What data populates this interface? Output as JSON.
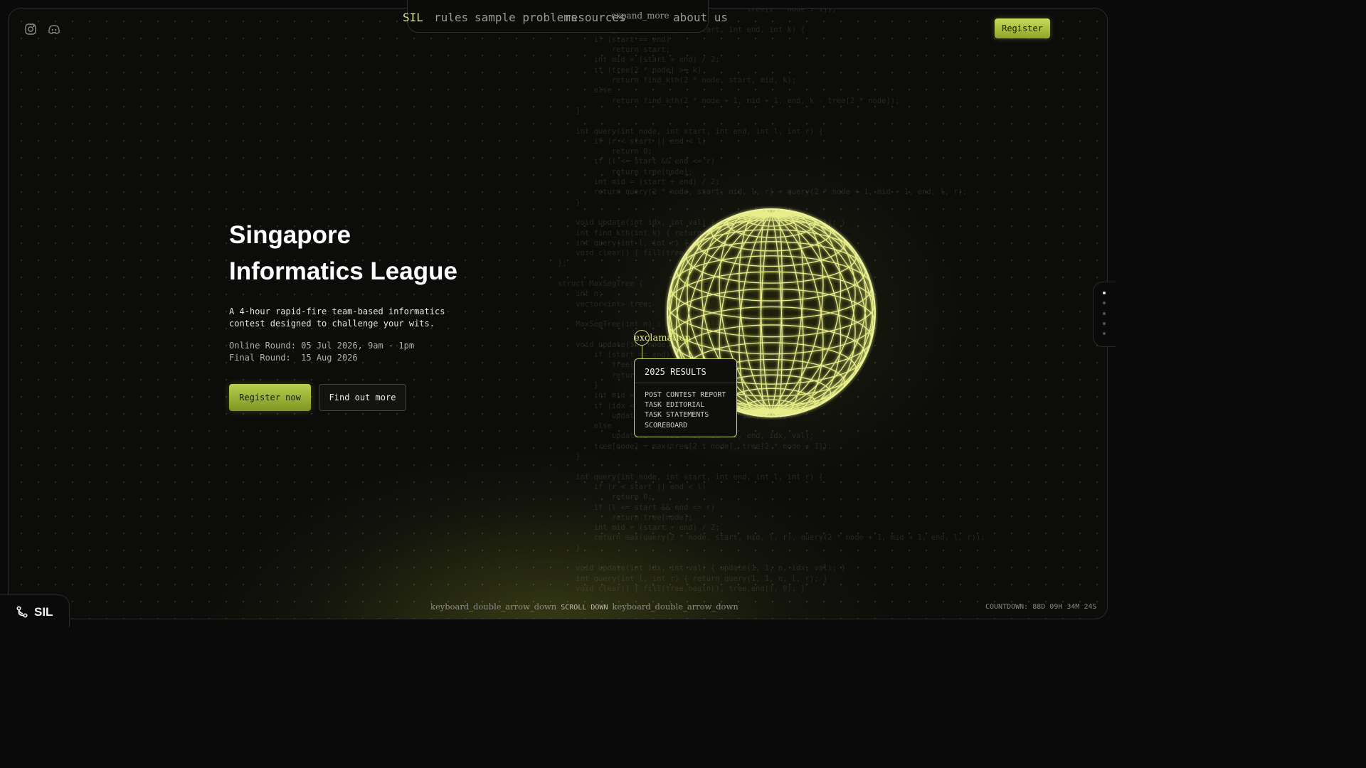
{
  "nav": {
    "items": [
      {
        "label": "SIL",
        "active": true
      },
      {
        "label": "rules"
      },
      {
        "label": "sample problems"
      },
      {
        "label": "resources"
      },
      {
        "label": "about us"
      }
    ],
    "resources_icon_text": "expand_more"
  },
  "socials": [
    {
      "icon": "instagram-icon"
    },
    {
      "icon": "discord-icon"
    }
  ],
  "header": {
    "register_label": "Register"
  },
  "hero": {
    "title_line1": "Singapore",
    "title_line2": "Informatics League",
    "description": "A 4-hour rapid-fire team-based informatics contest designed to challenge your wits.",
    "online_round": "Online Round: 05 Jul 2026, 9am - 1pm",
    "final_round": "Final Round:  15 Aug 2026",
    "primary_button": "Register now",
    "secondary_button": "Find out more"
  },
  "results_popup": {
    "anchor_icon_text": "exclamation",
    "title": "2025 RESULTS",
    "links": [
      "POST CONTEST REPORT",
      "TASK EDITORIAL",
      "TASK STATEMENTS",
      "SCOREBOARD"
    ]
  },
  "footer": {
    "logo_text": "SIL",
    "scroll_icon_text": "keyboard_double_arrow_down",
    "scroll_label": "SCROLL DOWN",
    "countdown": "COUNTDOWN: 88D 09H 34M 24S"
  },
  "side_nav": {
    "count": 5,
    "active_index": 0
  },
  "background_code": [
    "                                          tree[2 * node + 1]);",
    "",
    "    int find_kth(int node, int start, int end, int k) {",
    "        if (start == end)",
    "            return start;",
    "        int mid = (start + end) / 2;",
    "        if (tree[2 * node] >= k)",
    "            return find_kth(2 * node, start, mid, k);",
    "        else",
    "            return find_kth(2 * node + 1, mid + 1, end, k - tree[2 * node]);",
    "    }",
    "",
    "    int query(int node, int start, int end, int l, int r) {",
    "        if (r < start || end < l)",
    "            return 0;",
    "        if (l <= start && end <= r)",
    "            return tree[node];",
    "        int mid = (start + end) / 2;",
    "        return query(2 * node, start, mid, l, r) + query(2 * node + 1, mid + 1, end, l, r);",
    "    }",
    "",
    "    void update(int idx, int val) { update(1, 1, n, idx, val); }",
    "    int find_kth(int k) { return find_kth(1, 1, n, k); }",
    "    int query(int l, int r) { return query(1, 1, n, l, r); }",
    "    void clear() { fill(tree.begin(), tree.end(), 0); }",
    "};",
    "",
    "struct MaxSegTree {",
    "    int n;",
    "    vector<int> tree;",
    "",
    "    MaxSegTree(int n) : n(n), tree(4 * n) {}",
    "",
    "    void update(int node, int start, int end, int idx, int val) {",
    "        if (start == end) {",
    "            tree[node] = val;",
    "            return;",
    "        }",
    "        int mid = (start + end) / 2;",
    "        if (idx <= mid)",
    "            update(2 * node, start, mid, idx, val);",
    "        else",
    "            update(2 * node + 1, mid + 1, end, idx, val);",
    "        tree[node] = max(tree[2 * node], tree[2 * node + 1]);",
    "    }",
    "",
    "    int query(int node, int start, int end, int l, int r) {",
    "        if (r < start || end < l)",
    "            return 0;",
    "        if (l <= start && end <= r)",
    "            return tree[node];",
    "        int mid = (start + end) / 2;",
    "        return max(query(2 * node, start, mid, l, r), query(2 * node + 1, mid + 1, end, l, r));",
    "    }",
    "",
    "    void update(int idx, int val) { update(1, 1, n, idx, val); }",
    "    int query(int l, int r) { return query(1, 1, n, l, r); }",
    "    void clear() { fill(tree.begin(), tree.end(), 0); }"
  ],
  "colors": {
    "accent": "#d8e57a",
    "button_green": "#a5bc3c",
    "background": "#0a0a0a"
  }
}
